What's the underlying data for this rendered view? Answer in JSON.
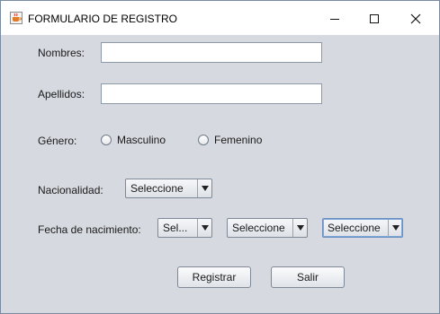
{
  "window": {
    "title": "FORMULARIO DE REGISTRO",
    "icon": "java-cup-icon"
  },
  "form": {
    "nombres_label": "Nombres:",
    "nombres_value": "",
    "apellidos_label": "Apellidos:",
    "apellidos_value": "",
    "genero_label": "Género:",
    "genero_options": [
      "Masculino",
      "Femenino"
    ],
    "nacionalidad_label": "Nacionalidad:",
    "nacionalidad_value": "Seleccione",
    "fecha_label": "Fecha de nacimiento:",
    "fecha_dia_value": "Sel...",
    "fecha_mes_value": "Seleccione",
    "fecha_anio_value": "Seleccione"
  },
  "buttons": {
    "registrar": "Registrar",
    "salir": "Salir"
  },
  "colors": {
    "background": "#d6d9df",
    "focus": "#7ea6d6"
  }
}
